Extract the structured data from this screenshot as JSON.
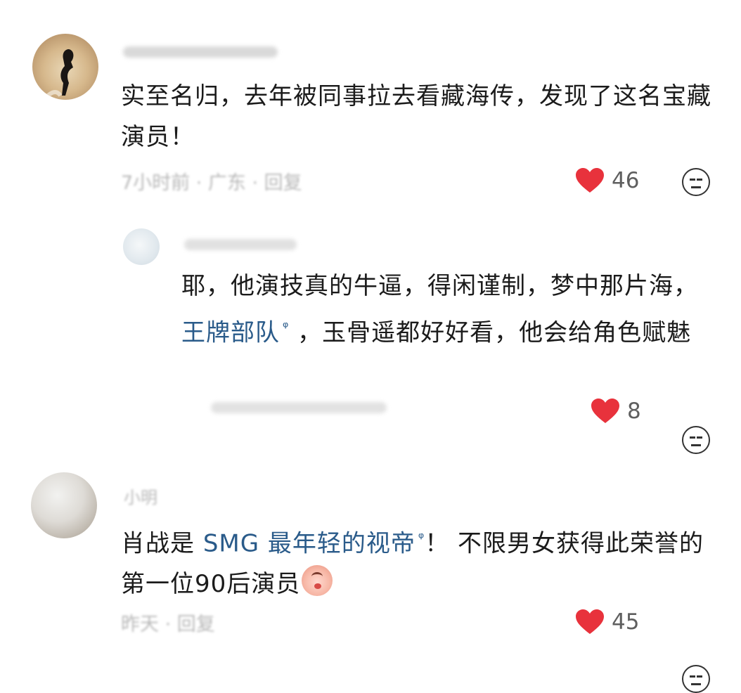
{
  "comments": [
    {
      "text": "实至名归，去年被同事拉去看藏海传，发现了这名宝藏演员！",
      "meta": "7小时前 · 广东 · 回复",
      "likes": "46"
    },
    {
      "text_before": "耶，他演技真的牛逼，得闲谨制，梦中那片海，",
      "link": "王牌部队",
      "text_after": "，玉骨遥都好好看，他会给角色赋魅",
      "likes": "8"
    },
    {
      "name": "小明",
      "text_before": "肖战是 ",
      "link": "SMG 最年轻的视帝",
      "text_after": "！ 不限男女获得此荣誉的第一位90后演员",
      "meta": "昨天 · 回复",
      "likes": "45"
    }
  ],
  "icons": {
    "like": "heart-icon",
    "reaction": "neutral-face-icon",
    "link": "search-icon",
    "emoji": "blush-peach-emoji"
  },
  "colors": {
    "like": "#e8323c",
    "link": "#2a5b8a",
    "meta": "#b8b8b8"
  }
}
